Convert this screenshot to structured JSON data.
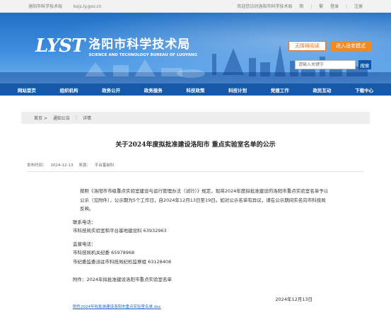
{
  "topbar": {
    "site_name": "洛阳市科学技术局",
    "domain": "kxjs.ly.gov.cn",
    "welcome": "欢迎您访问洛阳市科学技术局",
    "simplified": "简",
    "traditional": "繁",
    "login": "登录",
    "register": "注册"
  },
  "header": {
    "logo_mark": "LYST",
    "title_cn": "洛阳市科学技术局",
    "title_en": "SCIENCE AND TECHNOLOGY BUREAU OF LUOYANG",
    "care_mode": "无障碍阅读",
    "elder_mode": "进入适老模式",
    "search_placeholder": "请输入关键字",
    "search_button": "搜索"
  },
  "nav": {
    "items": [
      "网站首页",
      "组织机构",
      "政务公开",
      "政务服务",
      "科技政策",
      "科技计划",
      "党建工作",
      "政民互动",
      "下载中心"
    ]
  },
  "breadcrumb": {
    "home": "首页 >",
    "section": "通知公告",
    "current": "详情"
  },
  "article": {
    "title": "关于2024年度拟批准建设洛阳市 重点实验室名单的公示",
    "publish_label": "发布时间：",
    "publish_date": "2024-12-13",
    "source_label": "来源：",
    "source": "平台基础科",
    "para1": "按照《洛阳市市级重点实验室建设与运行管理办法（试行）》规定，现将2024年度拟批准建设的洛阳市重点实验室名单予以公示（见附件），公示期为5个工作日，自2024年12月13日至19日。如对公示名单有异议，请在公示期间实名向市科技局反映。",
    "contact_label": "联系电话：",
    "contact_line": "市科技局实验室和平台基地建设科 63932963",
    "supervise_label": "监督电话：",
    "supervise_line1": "市科技局机关纪委 65978968",
    "supervise_line2": "市纪委监委派驻市科技局纪检监察组 63128408",
    "attachment_note": "附件：2024年拟批准建设洛阳市重点实验室名单",
    "sign_date": "2024年12月13日",
    "attachment_link": "附件2024年拟批准建设洛阳市重点实验室名单.doc"
  }
}
